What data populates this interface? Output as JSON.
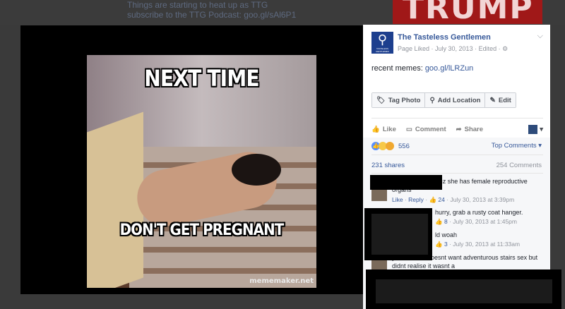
{
  "background": {
    "lines": [
      "Things are starting to heat up as TTG",
      "subscribe to the TTG Podcast: goo.gl/sAl6P1"
    ],
    "banner_text": "TRUMP"
  },
  "photo": {
    "top_text": "NEXT TIME",
    "bottom_text": "DON'T GET PREGNANT",
    "watermark": "mememaker.net"
  },
  "post": {
    "page_name": "The Tasteless Gentlemen",
    "logo_text": "TASTELESS GENTLEMEN",
    "meta": "Page Liked · July 30, 2013 · Edited ·",
    "caption_prefix": "recent memes: ",
    "caption_link": "goo.gl/lLRZun",
    "actions": [
      {
        "label": "Tag Photo",
        "icon": "tag-icon"
      },
      {
        "label": "Add Location",
        "icon": "location-icon"
      },
      {
        "label": "Edit",
        "icon": "pencil-icon"
      }
    ],
    "likebar": {
      "like": "Like",
      "comment": "Comment",
      "share": "Share"
    },
    "reaction_count": "556",
    "top_comments": "Top Comments ▾",
    "shares": "231 shares",
    "comments_count": "254 Comments"
  },
  "comments": [
    {
      "text": "r Hah it's funny cuz she has female reproductive organs",
      "like": "Like",
      "reply": "Reply",
      "likes": "24",
      "time": "July 30, 2013 at 3:39pm"
    },
    {
      "text": "hurry, grab a rusty coat hanger.",
      "likes": "8",
      "time": "July 30, 2013 at 1:45pm"
    },
    {
      "text": "ld woah",
      "likes": "3",
      "time": "July 30, 2013 at 11:33am"
    },
    {
      "text": "y When she doesnt want adventurous stairs sex but didnt realise it wasnt a"
    }
  ]
}
